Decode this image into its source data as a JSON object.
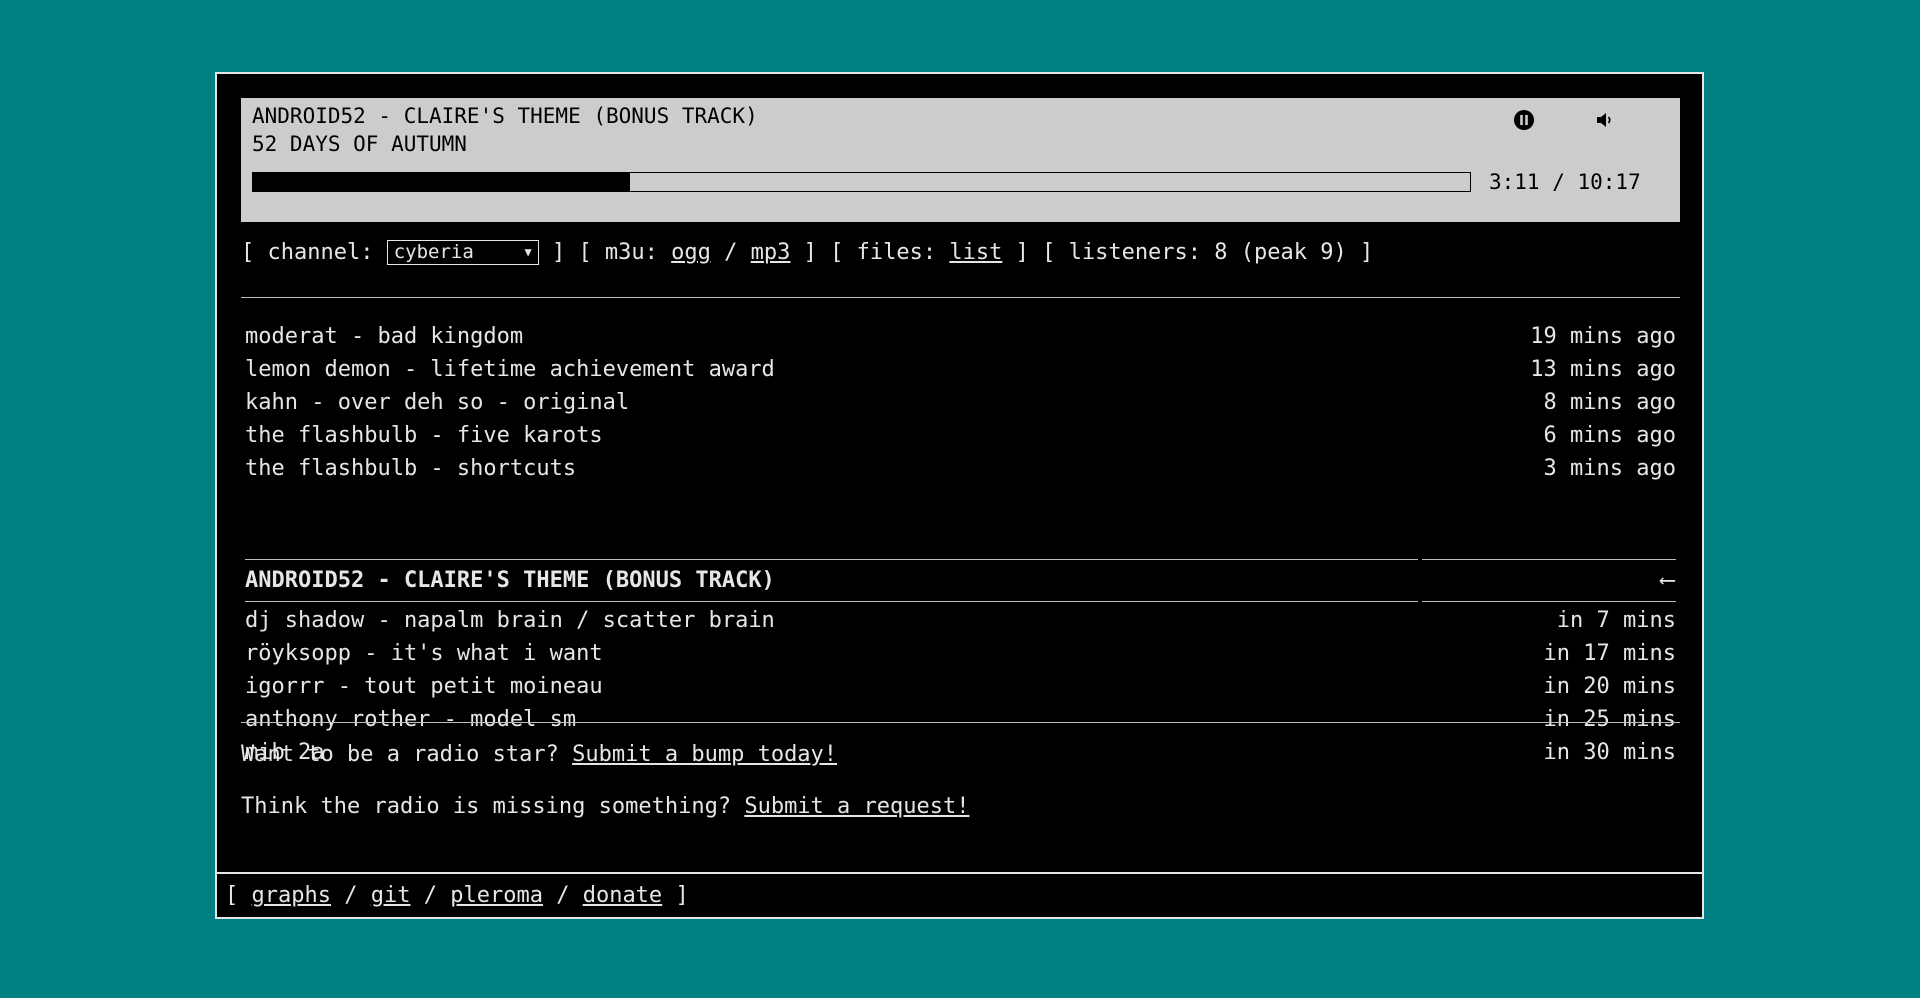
{
  "player": {
    "title": "ANDROID52 - CLAIRE'S THEME (BONUS TRACK)",
    "album": "52 DAYS OF AUTUMN",
    "time": "3:11 / 10:17",
    "progress_fraction": 0.31,
    "pause_icon": "pause-icon",
    "volume_icon": "volume-icon"
  },
  "info": {
    "open1": "[ channel:",
    "channel_selected": "cyberia",
    "close1": "] [ m3u:",
    "ogg": "ogg",
    "sep1": "/",
    "mp3": "mp3",
    "close2": "] [ files:",
    "list": "list",
    "close3": "] [ listeners: 8 (peak 9) ]"
  },
  "history": [
    {
      "track": "moderat - bad kingdom",
      "when": "19 mins ago"
    },
    {
      "track": "lemon demon - lifetime achievement award",
      "when": "13 mins ago"
    },
    {
      "track": "kahn - over deh so - original",
      "when": "8 mins ago"
    },
    {
      "track": "the flashbulb - five karots",
      "when": "6 mins ago"
    },
    {
      "track": "the flashbulb - shortcuts",
      "when": "3 mins ago"
    }
  ],
  "current": {
    "track": "ANDROID52 - CLAIRE'S THEME (BONUS TRACK)",
    "marker": "⟵"
  },
  "upcoming": [
    {
      "track": "dj shadow - napalm brain / scatter brain",
      "when": "in 7 mins"
    },
    {
      "track": "röyksopp - it's what i want",
      "when": "in 17 mins"
    },
    {
      "track": "igorrr - tout petit moineau",
      "when": "in 20 mins"
    },
    {
      "track": "anthony rother - model sm",
      "when": "in 25 mins"
    },
    {
      "track": "mib 2a",
      "when": "in 30 mins"
    }
  ],
  "promo": {
    "bump_text": "Want to be a radio star?",
    "bump_link": "Submit a bump today!",
    "request_text": "Think the radio is missing something?",
    "request_link": "Submit a request!"
  },
  "footer": {
    "open": "[",
    "graphs": "graphs",
    "sep1": "/",
    "git": "git",
    "sep2": "/",
    "pleroma": "pleroma",
    "sep3": "/",
    "donate": "donate",
    "close": "]"
  }
}
